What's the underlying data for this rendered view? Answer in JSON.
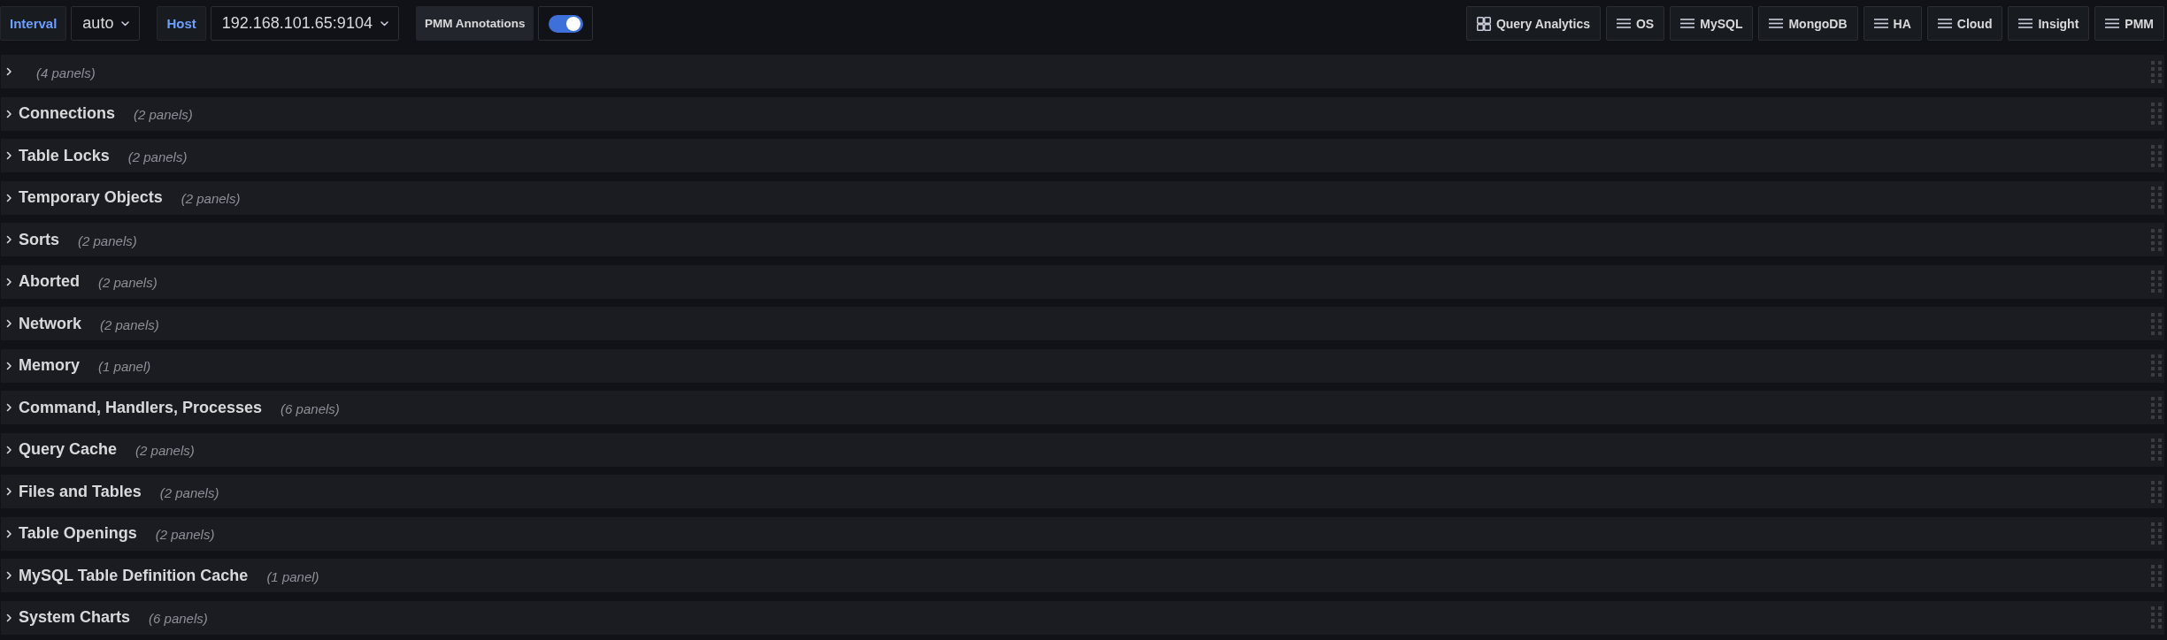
{
  "variables": [
    {
      "label": "Interval",
      "value": "auto"
    },
    {
      "label": "Host",
      "value": "192.168.101.65:9104"
    }
  ],
  "annotations": {
    "label": "PMM Annotations",
    "enabled": true
  },
  "links": [
    {
      "label": "Query Analytics",
      "kind": "link"
    },
    {
      "label": "OS",
      "kind": "dropdown"
    },
    {
      "label": "MySQL",
      "kind": "dropdown"
    },
    {
      "label": "MongoDB",
      "kind": "dropdown"
    },
    {
      "label": "HA",
      "kind": "dropdown"
    },
    {
      "label": "Cloud",
      "kind": "dropdown"
    },
    {
      "label": "Insight",
      "kind": "dropdown"
    },
    {
      "label": "PMM",
      "kind": "dropdown"
    }
  ],
  "rows": [
    {
      "count": "(4 panels)",
      "collapsed": true
    },
    {
      "title": "Connections",
      "count": "(2 panels)",
      "collapsed": true
    },
    {
      "title": "Table Locks",
      "count": "(2 panels)",
      "collapsed": true
    },
    {
      "title": "Temporary Objects",
      "count": "(2 panels)",
      "collapsed": true
    },
    {
      "title": "Sorts",
      "count": "(2 panels)",
      "collapsed": true
    },
    {
      "title": "Aborted",
      "count": "(2 panels)",
      "collapsed": true
    },
    {
      "title": "Network",
      "count": "(2 panels)",
      "collapsed": true
    },
    {
      "title": "Memory",
      "count": "(1 panel)",
      "collapsed": true
    },
    {
      "title": "Command, Handlers, Processes",
      "count": "(6 panels)",
      "collapsed": true
    },
    {
      "title": "Query Cache",
      "count": "(2 panels)",
      "collapsed": true
    },
    {
      "title": "Files and Tables",
      "count": "(2 panels)",
      "collapsed": true
    },
    {
      "title": "Table Openings",
      "count": "(2 panels)",
      "collapsed": true
    },
    {
      "title": "MySQL Table Definition Cache",
      "count": "(1 panel)",
      "collapsed": true
    },
    {
      "title": "System Charts",
      "count": "(6 panels)",
      "collapsed": true
    }
  ]
}
